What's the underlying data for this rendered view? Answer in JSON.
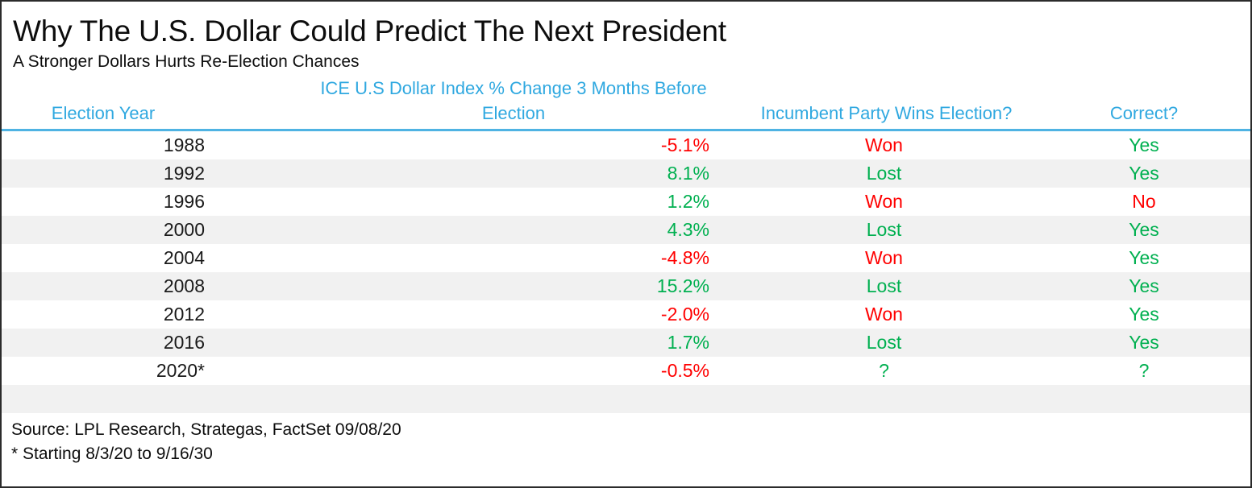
{
  "title": "Why The U.S. Dollar Could Predict The Next President",
  "subtitle": "A Stronger Dollars Hurts Re-Election Chances",
  "colors": {
    "header_blue": "#2fa8e0",
    "rule_blue": "#4fb3e3",
    "positive_green": "#00b050",
    "negative_red": "#ff0000",
    "text_black": "#0d0d0d",
    "stripe_gray": "#f1f1f1",
    "border": "#2b2b2b"
  },
  "table": {
    "headers": {
      "year": "Election Year",
      "change": "ICE U.S Dollar Index % Change 3 Months Before Election",
      "wins": "Incumbent Party Wins Election?",
      "correct": "Correct?"
    },
    "rows": [
      {
        "year": "1988",
        "change": "-5.1%",
        "change_sign": "neg",
        "wins": "Won",
        "wins_sign": "neg",
        "correct": "Yes",
        "correct_sign": "pos"
      },
      {
        "year": "1992",
        "change": "8.1%",
        "change_sign": "pos",
        "wins": "Lost",
        "wins_sign": "pos",
        "correct": "Yes",
        "correct_sign": "pos"
      },
      {
        "year": "1996",
        "change": "1.2%",
        "change_sign": "pos",
        "wins": "Won",
        "wins_sign": "neg",
        "correct": "No",
        "correct_sign": "neg"
      },
      {
        "year": "2000",
        "change": "4.3%",
        "change_sign": "pos",
        "wins": "Lost",
        "wins_sign": "pos",
        "correct": "Yes",
        "correct_sign": "pos"
      },
      {
        "year": "2004",
        "change": "-4.8%",
        "change_sign": "neg",
        "wins": "Won",
        "wins_sign": "neg",
        "correct": "Yes",
        "correct_sign": "pos"
      },
      {
        "year": "2008",
        "change": "15.2%",
        "change_sign": "pos",
        "wins": "Lost",
        "wins_sign": "pos",
        "correct": "Yes",
        "correct_sign": "pos"
      },
      {
        "year": "2012",
        "change": "-2.0%",
        "change_sign": "neg",
        "wins": "Won",
        "wins_sign": "neg",
        "correct": "Yes",
        "correct_sign": "pos"
      },
      {
        "year": "2016",
        "change": "1.7%",
        "change_sign": "pos",
        "wins": "Lost",
        "wins_sign": "pos",
        "correct": "Yes",
        "correct_sign": "pos"
      },
      {
        "year": "2020*",
        "change": "-0.5%",
        "change_sign": "neg",
        "wins": "?",
        "wins_sign": "unknown",
        "correct": "?",
        "correct_sign": "unknown"
      }
    ]
  },
  "chart_data": {
    "type": "table",
    "title": "Why The U.S. Dollar Could Predict The Next President",
    "subtitle": "A Stronger Dollars Hurts Re-Election Chances",
    "columns": [
      "Election Year",
      "ICE U.S Dollar Index % Change 3 Months Before Election",
      "Incumbent Party Wins Election?",
      "Correct?"
    ],
    "categories": [
      "1988",
      "1992",
      "1996",
      "2000",
      "2004",
      "2008",
      "2012",
      "2016",
      "2020*"
    ],
    "series": [
      {
        "name": "ICE U.S Dollar Index % Change 3 Months Before Election",
        "values": [
          -5.1,
          8.1,
          1.2,
          4.3,
          -4.8,
          15.2,
          -2.0,
          1.7,
          -0.5
        ]
      },
      {
        "name": "Incumbent Party Wins Election?",
        "values": [
          "Won",
          "Lost",
          "Won",
          "Lost",
          "Won",
          "Lost",
          "Won",
          "Lost",
          "?"
        ]
      },
      {
        "name": "Correct?",
        "values": [
          "Yes",
          "Yes",
          "No",
          "Yes",
          "Yes",
          "Yes",
          "Yes",
          "Yes",
          "?"
        ]
      }
    ],
    "notes": [
      "Source: LPL Research, Strategas, FactSet 09/08/20",
      "* Starting 8/3/20 to 9/16/30"
    ],
    "grid": false,
    "legend": "none"
  },
  "footnotes": {
    "source": "Source: LPL Research, Strategas, FactSet 09/08/20",
    "asterisk": "* Starting 8/3/20 to 9/16/30"
  }
}
